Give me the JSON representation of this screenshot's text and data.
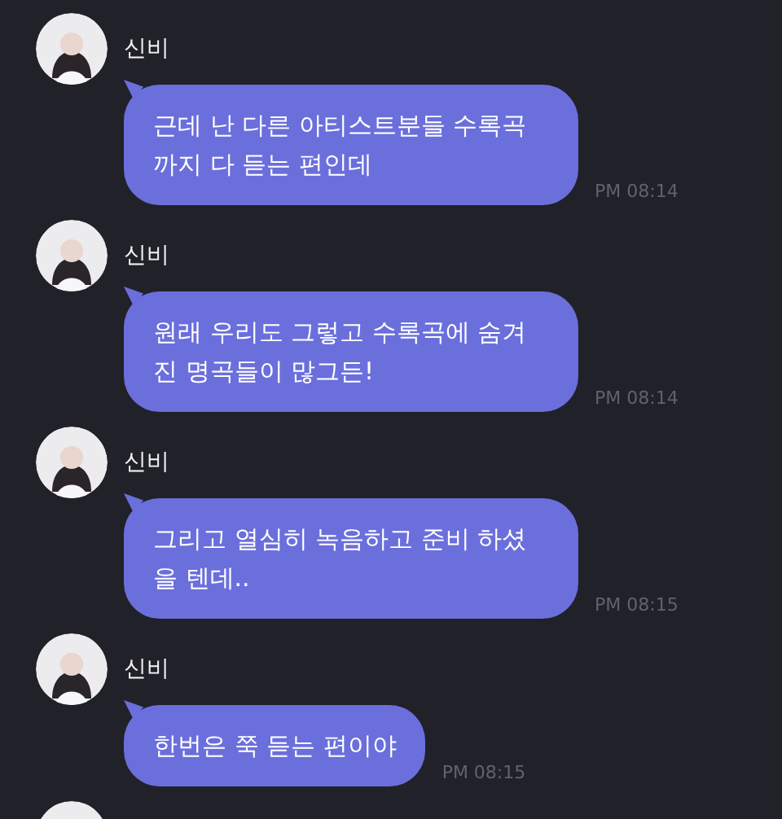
{
  "messages": [
    {
      "kind": "message",
      "sender": "신비",
      "text": "근데 난 다른 아티스트분들 수록곡까지 다 듣는 편인데",
      "time": "PM 08:14"
    },
    {
      "kind": "message",
      "sender": "신비",
      "text": "원래 우리도 그렇고 수록곡에 숨겨진 명곡들이 많그든!",
      "time": "PM 08:14"
    },
    {
      "kind": "message",
      "sender": "신비",
      "text": "그리고 열심히 녹음하고 준비 하셨을 텐데..",
      "time": "PM 08:15"
    },
    {
      "kind": "message",
      "sender": "신비",
      "text": "한번은 쭉 듣는 편이야",
      "time": "PM 08:15"
    },
    {
      "kind": "avatar_only"
    }
  ]
}
